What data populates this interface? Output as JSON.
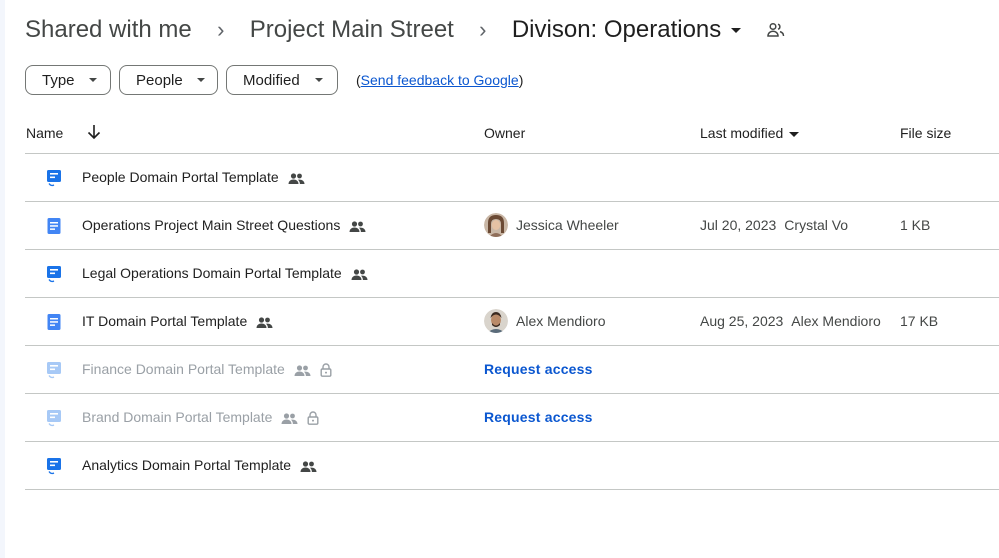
{
  "breadcrumb": {
    "items": [
      "Shared with me",
      "Project Main Street",
      "Divison: Operations"
    ],
    "separator": "›"
  },
  "filters": {
    "type_label": "Type",
    "people_label": "People",
    "modified_label": "Modified",
    "feedback_open": "(",
    "feedback_link": "Send feedback to Google",
    "feedback_close": ")"
  },
  "table": {
    "headers": {
      "name": "Name",
      "owner": "Owner",
      "last_modified": "Last modified",
      "file_size": "File size"
    },
    "rows": [
      {
        "name": "People Domain Portal Template",
        "icon": "form-icon"
      },
      {
        "name": "Operations Project Main Street Questions",
        "icon": "doc-icon",
        "owner": "Jessica Wheeler",
        "modified_date": "Jul 20, 2023",
        "modified_by": "Crystal Vo",
        "size": "1 KB"
      },
      {
        "name": "Legal Operations Domain Portal Template",
        "icon": "form-icon"
      },
      {
        "name": "IT Domain Portal Template",
        "icon": "doc-icon",
        "owner": "Alex Mendioro",
        "modified_date": "Aug 25, 2023",
        "modified_by": "Alex Mendioro",
        "size": "17 KB"
      },
      {
        "name": "Finance Domain Portal Template",
        "icon": "form-icon",
        "locked": true,
        "action": "Request access"
      },
      {
        "name": "Brand Domain Portal Template",
        "icon": "form-icon",
        "locked": true,
        "action": "Request access"
      },
      {
        "name": "Analytics Domain Portal Template",
        "icon": "form-icon"
      }
    ]
  },
  "colors": {
    "link": "#0b57d0",
    "doc_icon": "#4285f4",
    "form_icon": "#1a73e8",
    "divider": "#c4c7c5"
  }
}
